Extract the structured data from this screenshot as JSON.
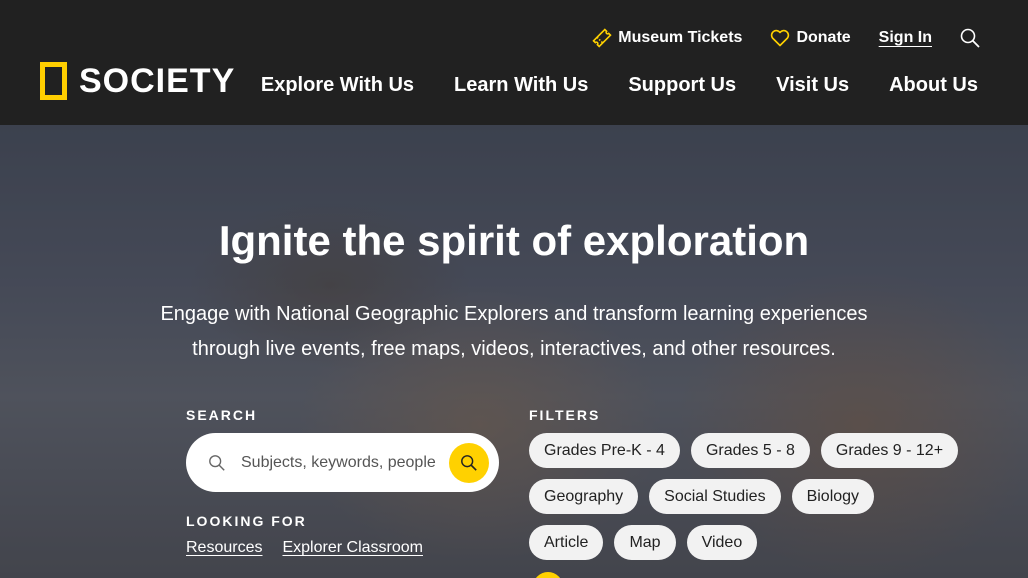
{
  "header": {
    "utility": {
      "tickets": "Museum Tickets",
      "donate": "Donate",
      "signin": "Sign In"
    },
    "logo_text": "SOCIETY",
    "nav": [
      "Explore With Us",
      "Learn With Us",
      "Support Us",
      "Visit Us",
      "About Us"
    ]
  },
  "hero": {
    "title": "Ignite the spirit of exploration",
    "subtitle": "Engage with National Geographic Explorers and transform learning experiences through live events, free maps, videos, interactives, and other resources."
  },
  "search": {
    "label": "SEARCH",
    "placeholder": "Subjects, keywords, people"
  },
  "looking_for": {
    "label": "LOOKING FOR",
    "links": [
      "Resources",
      "Explorer Classroom"
    ]
  },
  "filters": {
    "label": "FILTERS",
    "rows": [
      [
        "Grades Pre-K - 4",
        "Grades 5 - 8",
        "Grades 9 - 12+"
      ],
      [
        "Geography",
        "Social Studies",
        "Biology"
      ],
      [
        "Article",
        "Map",
        "Video"
      ]
    ]
  },
  "colors": {
    "header_bg": "#212121",
    "accent_yellow": "#ffd100",
    "logo_yellow": "#ffce00",
    "chip_bg": "#f2f2f2"
  },
  "icons": [
    "ticket-icon",
    "heart-icon",
    "search-icon",
    "magnifier-icon"
  ]
}
